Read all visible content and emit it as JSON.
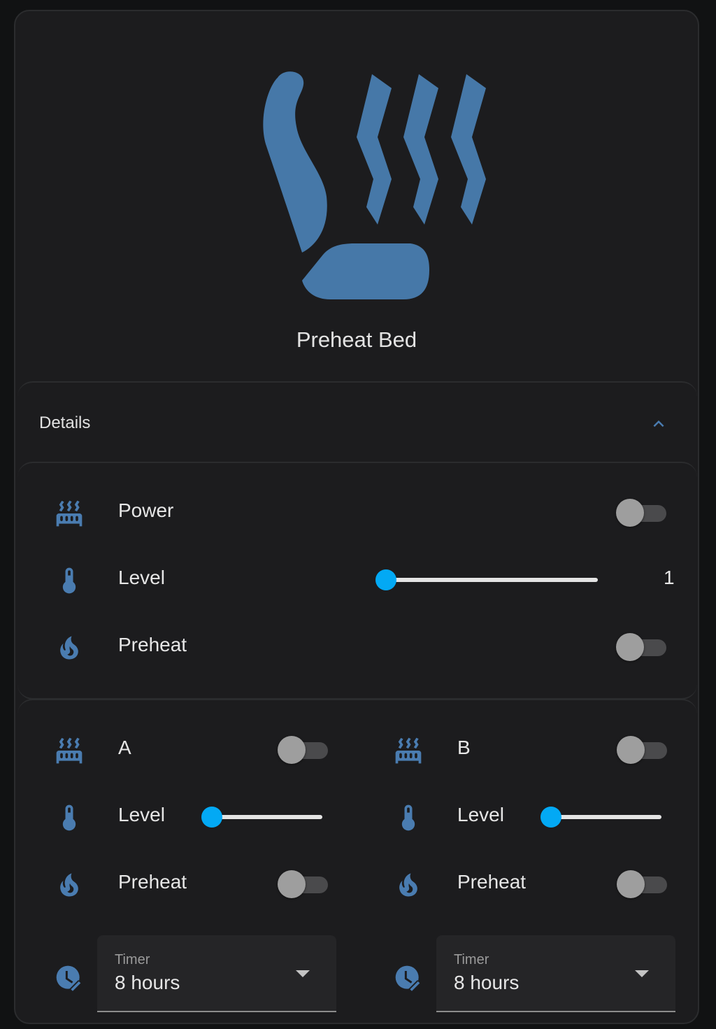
{
  "hero": {
    "icon": "heated-seat-icon",
    "title": "Preheat Bed"
  },
  "details": {
    "title": "Details",
    "expanded": true,
    "toggle_icon": "chevron-up-icon"
  },
  "main_section": {
    "rows": [
      {
        "icon": "radiator-icon",
        "label": "Power",
        "control": "toggle",
        "state": "off"
      },
      {
        "icon": "thermometer-icon",
        "label": "Level",
        "control": "slider",
        "value": 1,
        "value_text": "1",
        "position_fraction": 0.0
      },
      {
        "icon": "fire-icon",
        "label": "Preheat",
        "control": "toggle",
        "state": "off"
      }
    ]
  },
  "zones": [
    {
      "name": "A",
      "power": {
        "icon": "radiator-icon",
        "label": "A",
        "state": "off"
      },
      "level": {
        "icon": "thermometer-icon",
        "label": "Level",
        "position_fraction": 0.0
      },
      "preheat": {
        "icon": "fire-icon",
        "label": "Preheat",
        "state": "off"
      },
      "timer": {
        "icon": "clock-edit-icon",
        "label": "Timer",
        "value": "8 hours"
      }
    },
    {
      "name": "B",
      "power": {
        "icon": "radiator-icon",
        "label": "B",
        "state": "off"
      },
      "level": {
        "icon": "thermometer-icon",
        "label": "Level",
        "position_fraction": 0.0
      },
      "preheat": {
        "icon": "fire-icon",
        "label": "Preheat",
        "state": "off"
      },
      "timer": {
        "icon": "clock-edit-icon",
        "label": "Timer",
        "value": "8 hours"
      }
    }
  ],
  "colors": {
    "accent": "#03a9f4",
    "icon": "#4678a8",
    "background": "#1c1c1e",
    "toggle_off_thumb": "#9e9e9e",
    "toggle_off_track": "#4a4a4c"
  }
}
